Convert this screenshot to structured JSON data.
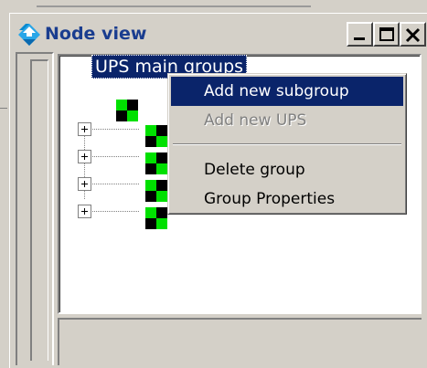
{
  "window": {
    "title": "Node view",
    "title_icon": "diamond-arrows-icon",
    "controls": {
      "minimize_icon": "minimize-icon",
      "maximize_icon": "maximize-icon",
      "close_icon": "close-icon"
    }
  },
  "tree": {
    "root": {
      "label": "UPS main groups",
      "icon": "group-node-icon",
      "selected": true
    },
    "children": [
      {
        "icon": "group-node-icon",
        "collapsed": true
      },
      {
        "icon": "group-node-icon",
        "collapsed": true
      },
      {
        "icon": "group-node-icon",
        "collapsed": true
      },
      {
        "icon": "group-node-icon",
        "collapsed": true
      }
    ]
  },
  "context_menu": {
    "items": [
      {
        "label": "Add new subgroup",
        "state": "highlighted"
      },
      {
        "label": "Add new UPS",
        "state": "disabled"
      },
      {
        "separator": true
      },
      {
        "label": "Delete group",
        "state": "normal"
      },
      {
        "label": "Group Properties",
        "state": "normal"
      }
    ]
  },
  "colors": {
    "selection": "#0a246a",
    "title_text": "#1a3d8f",
    "node_green": "#00e000",
    "face": "#d4d0c8"
  }
}
